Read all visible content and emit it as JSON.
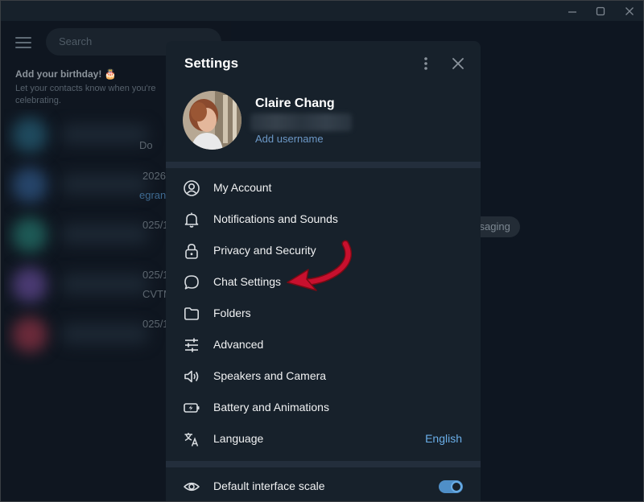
{
  "window": {
    "controls": [
      "minimize",
      "maximize",
      "close"
    ]
  },
  "sidebar": {
    "search_placeholder": "Search",
    "birthday_title": "Add your birthday! 🎂",
    "birthday_subtitle": "Let your contacts know when you're celebrating.",
    "chat_fragments": [
      "Do",
      "2026",
      "egran",
      "025/1",
      "025/1",
      "CVTM",
      "025/1"
    ]
  },
  "background_chat": {
    "pill_text": "ssaging"
  },
  "settings": {
    "title": "Settings",
    "profile": {
      "name": "Claire Chang",
      "add_username": "Add username"
    },
    "items": [
      {
        "label": "My Account",
        "icon": "account-icon"
      },
      {
        "label": "Notifications and Sounds",
        "icon": "bell-icon"
      },
      {
        "label": "Privacy and Security",
        "icon": "lock-icon"
      },
      {
        "label": "Chat Settings",
        "icon": "chat-bubble-icon"
      },
      {
        "label": "Folders",
        "icon": "folder-icon"
      },
      {
        "label": "Advanced",
        "icon": "sliders-icon"
      },
      {
        "label": "Speakers and Camera",
        "icon": "speaker-icon"
      },
      {
        "label": "Battery and Animations",
        "icon": "battery-icon"
      },
      {
        "label": "Language",
        "icon": "translate-icon",
        "value": "English"
      }
    ],
    "scale": {
      "label": "Default interface scale",
      "icon": "eye-icon",
      "enabled": true
    }
  },
  "colors": {
    "accent": "#6aaee8",
    "dialog_bg": "#17212b",
    "annotation_arrow": "#c8102e"
  }
}
